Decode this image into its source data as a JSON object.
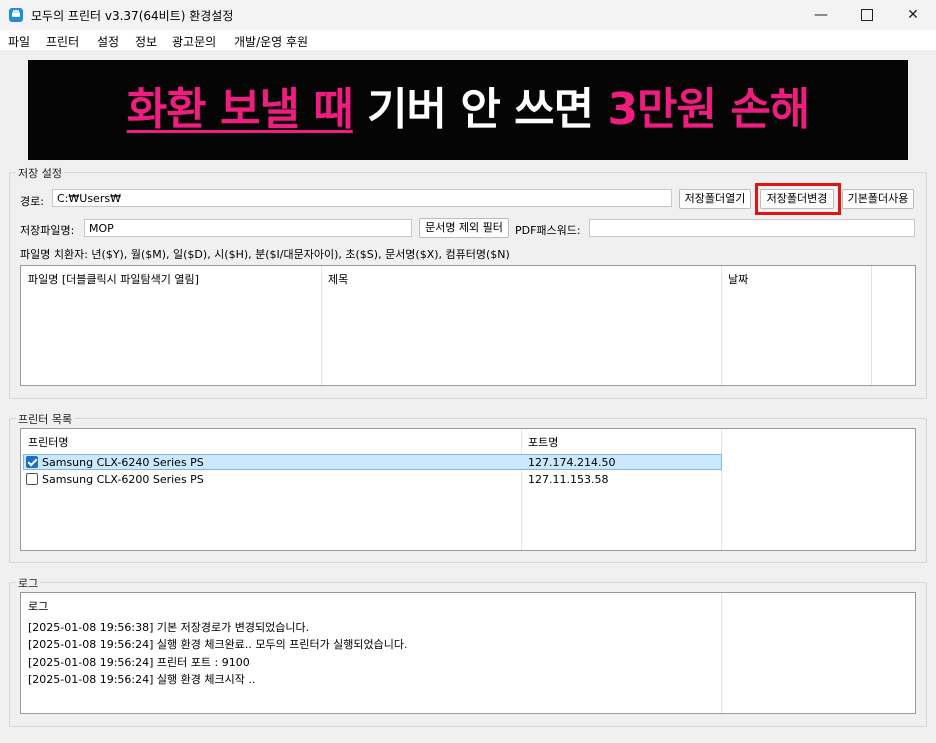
{
  "window": {
    "title": "모두의 프린터 v3.37(64비트) 환경설정",
    "minimize_icon": "minimize-icon",
    "maximize_icon": "maximize-icon",
    "close_icon": "close-icon"
  },
  "menu": [
    "파일",
    "프린터",
    "설정",
    "정보",
    "광고문의",
    "개발/운영 후원"
  ],
  "banner": {
    "part1": "화환 보낼 때",
    "part2": " 기버 안 쓰면 ",
    "part3": "3만원 손해",
    "colors": {
      "accent": "#ef1d7f",
      "background": "#050505",
      "text": "#ffffff"
    }
  },
  "save_settings": {
    "group_title": "저장 설정",
    "path_label": "경로:",
    "path_value": "C:₩Users₩",
    "open_folder_button": "저장폴더열기",
    "change_folder_button": "저장폴더변경",
    "default_folder_button": "기본폴더사용",
    "filename_label": "저장파일명:",
    "filename_value": "MOP",
    "doc_filter_button": "문서명 제외 필터",
    "pdf_password_label": "PDF패스워드:",
    "pdf_password_value": "",
    "substitution_hint": "파일명 치환자: 년($Y), 월($M), 일($D), 시($H), 분($I/대문자아이), 초($S), 문서명($X), 컴퓨터명($N)",
    "table_headers": [
      "파일명 [더블클릭시 파일탐색기 열림]",
      "제목",
      "날짜"
    ],
    "rows": []
  },
  "printer_list": {
    "group_title": "프린터 목록",
    "headers": [
      "프린터명",
      "포트명"
    ],
    "rows": [
      {
        "name": "Samsung CLX-6240 Series PS",
        "port": "127.174.214.50",
        "checked": true,
        "selected": true
      },
      {
        "name": "Samsung CLX-6200 Series PS",
        "port": "127.11.153.58",
        "checked": false,
        "selected": false
      }
    ]
  },
  "log": {
    "group_title": "로그",
    "header": "로그",
    "entries": [
      "[2025-01-08 19:56:38] 기본 저장경로가 변경되었습니다.",
      "[2025-01-08 19:56:24] 실행 환경 체크완료.. 모두의 프린터가 실행되었습니다.",
      "[2025-01-08 19:56:24] 프린터 포트 : 9100",
      "[2025-01-08 19:56:24] 실행 환경 체크시작 .."
    ]
  },
  "highlight_color": "#e01414"
}
